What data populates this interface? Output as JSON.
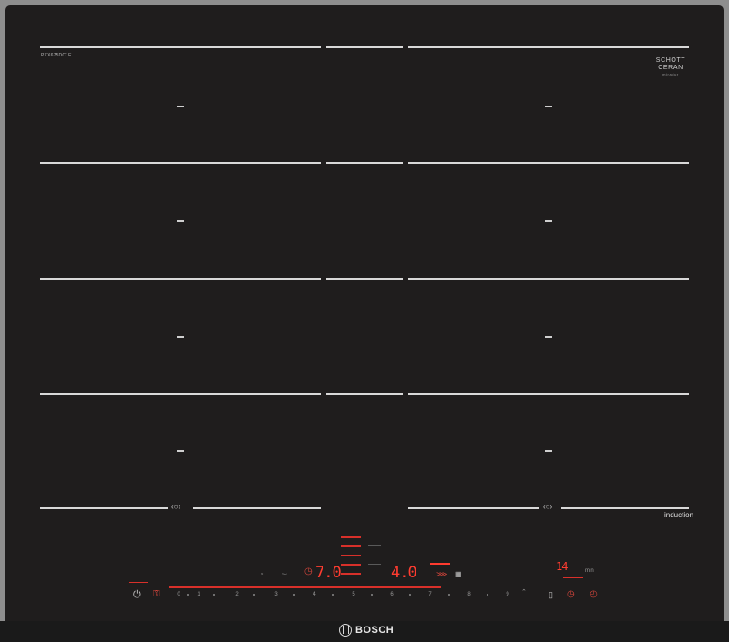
{
  "model_code": "PXX675DC1E",
  "schott": {
    "line1": "SCHOTT",
    "line2": "CERAN",
    "line3": "miradur"
  },
  "flex_symbol": "‹○›",
  "induction_label": "induction",
  "zone_displays": {
    "left_level": "7.0",
    "center_level": "4.0",
    "timer": "14"
  },
  "slider_numbers": [
    "0",
    "1",
    "2",
    "3",
    "4",
    "5",
    "6",
    "7",
    "8",
    "9"
  ],
  "colors": {
    "glass": "#1f1d1d",
    "frame": "#8e8e8e",
    "touch_red": "#e03a32",
    "marking_white": "#d8d8d8"
  },
  "icons": {
    "power": "power-icon",
    "child_lock": "child-lock-icon",
    "move_mode": "move-icon",
    "timer": "clock-icon",
    "wipe_protect": "wipe-protect-icon",
    "stopwatch": "stopwatch-icon"
  },
  "brand": "BOSCH"
}
